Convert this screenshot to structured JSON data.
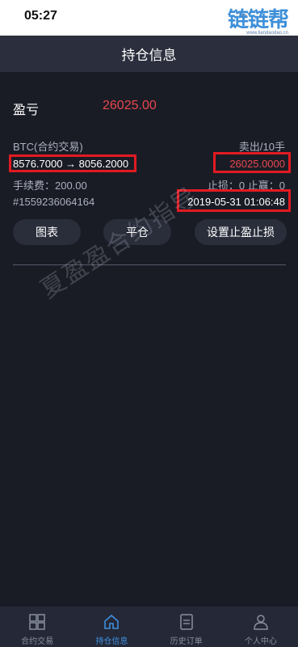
{
  "status_bar": {
    "time": "05:27"
  },
  "watermark_logo": {
    "text": "链链帮",
    "subtext": "www.liandaodao.cn"
  },
  "header": {
    "title": "持仓信息"
  },
  "position": {
    "pnl_label": "盈亏",
    "pnl_value": "26025.00",
    "contract": "BTC(合约交易)",
    "side": "卖出/10手",
    "price_range": "8576.7000 → 8056.2000",
    "profit_value": "26025.0000",
    "fee": "手续费：200.00",
    "stop_info": "止损：0  止赢：0",
    "order_id": "#1559236064164",
    "time": "2019-05-31 01:06:48"
  },
  "actions": {
    "chart": "图表",
    "close": "平仓",
    "set_sl_tp": "设置止盈止损"
  },
  "overlay_watermark": "夏盈盈合约指导",
  "nav": {
    "items": [
      {
        "label": "合约交易",
        "icon": "grid-icon"
      },
      {
        "label": "持仓信息",
        "icon": "home-icon"
      },
      {
        "label": "历史订单",
        "icon": "document-icon"
      },
      {
        "label": "个人中心",
        "icon": "user-icon"
      }
    ],
    "active_index": 1
  },
  "colors": {
    "background": "#1a1c25",
    "header": "#2b2f3d",
    "profit_red": "#e8474f",
    "accent_blue": "#3d8fe0",
    "annotation_red": "#e11a22"
  }
}
